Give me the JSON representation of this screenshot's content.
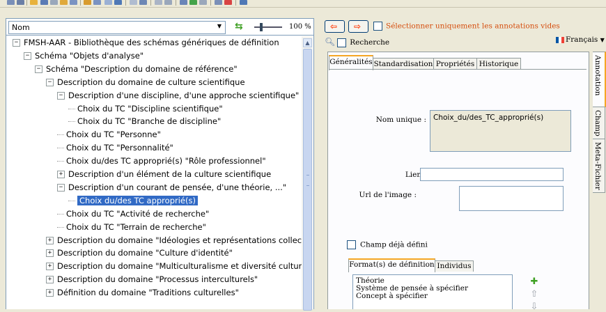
{
  "left": {
    "combo_value": "Nom",
    "zoom": "100 %",
    "tree": [
      {
        "label": "FMSH-AAR - Bibliothèque des schémas génériques de définition",
        "depth": 0,
        "toggle": "−"
      },
      {
        "label": "Schéma \"Objets d'analyse\"",
        "depth": 1,
        "toggle": "−"
      },
      {
        "label": "Schéma \"Description du domaine de référence\"",
        "depth": 2,
        "toggle": "−"
      },
      {
        "label": "Description du domaine de culture scientifique",
        "depth": 3,
        "toggle": "−"
      },
      {
        "label": "Description d'une discipline, d'une approche scientifique\"",
        "depth": 4,
        "toggle": "−"
      },
      {
        "label": "Choix du TC \"Discipline scientifique\"",
        "depth": 5,
        "toggle": ""
      },
      {
        "label": "Choix du TC \"Branche de discipline\"",
        "depth": 5,
        "toggle": ""
      },
      {
        "label": "Choix du TC \"Personne\"",
        "depth": 4,
        "toggle": ""
      },
      {
        "label": "Choix du TC \"Personnalité\"",
        "depth": 4,
        "toggle": ""
      },
      {
        "label": "Choix du/des TC approprié(s) \"Rôle professionnel\"",
        "depth": 4,
        "toggle": ""
      },
      {
        "label": "Description d'un élément de la culture scientifique",
        "depth": 4,
        "toggle": "+"
      },
      {
        "label": "Description d'un courant de pensée, d'une théorie, ...\"",
        "depth": 4,
        "toggle": "−"
      },
      {
        "label": "Choix du/des TC approprié(s)",
        "depth": 5,
        "toggle": "",
        "selected": true
      },
      {
        "label": "Choix du TC \"Activité de recherche\"",
        "depth": 4,
        "toggle": ""
      },
      {
        "label": "Choix du TC \"Terrain de recherche\"",
        "depth": 4,
        "toggle": ""
      },
      {
        "label": "Description du domaine \"Idéologies et représentations collectiv",
        "depth": 3,
        "toggle": "+"
      },
      {
        "label": "Description du domaine \"Culture d'identité\"",
        "depth": 3,
        "toggle": "+"
      },
      {
        "label": "Description du domaine \"Multiculturalisme et diversité culturelle",
        "depth": 3,
        "toggle": "+"
      },
      {
        "label": "Description du domaine \"Processus interculturels\"",
        "depth": 3,
        "toggle": "+"
      },
      {
        "label": "Définition du domaine \"Traditions culturelles\"",
        "depth": 3,
        "toggle": "+"
      }
    ]
  },
  "right": {
    "only_empty_label": "Sélectionner uniquement les annotations vides",
    "search_label": "Recherche",
    "language": "Français",
    "tabs": [
      "Généralités",
      "Standardisation",
      "Propriétés",
      "Historique"
    ],
    "unique_name_label": "Nom unique :",
    "unique_name_value": "Choix_du/des_TC_approprié(s)",
    "link_label": "Lien :",
    "link_value": "",
    "image_url_label": "Url de l'image :",
    "image_url_value": "",
    "already_defined_label": "Champ déjà défini",
    "sub_tabs": [
      "Format(s) de définition",
      "Individus"
    ],
    "formats": [
      "Théorie",
      "Système de pensée à spécifier",
      "Concept à spécifier"
    ],
    "vertical_tabs": [
      "Annotation",
      "Champ",
      "Meta-Fichier"
    ]
  },
  "colors": {
    "selection": "#316ac5",
    "accent_tab": "#f5a623",
    "warning_text": "#d54d0d",
    "arrow": "#ff3300",
    "add_icon": "#3fa024"
  }
}
